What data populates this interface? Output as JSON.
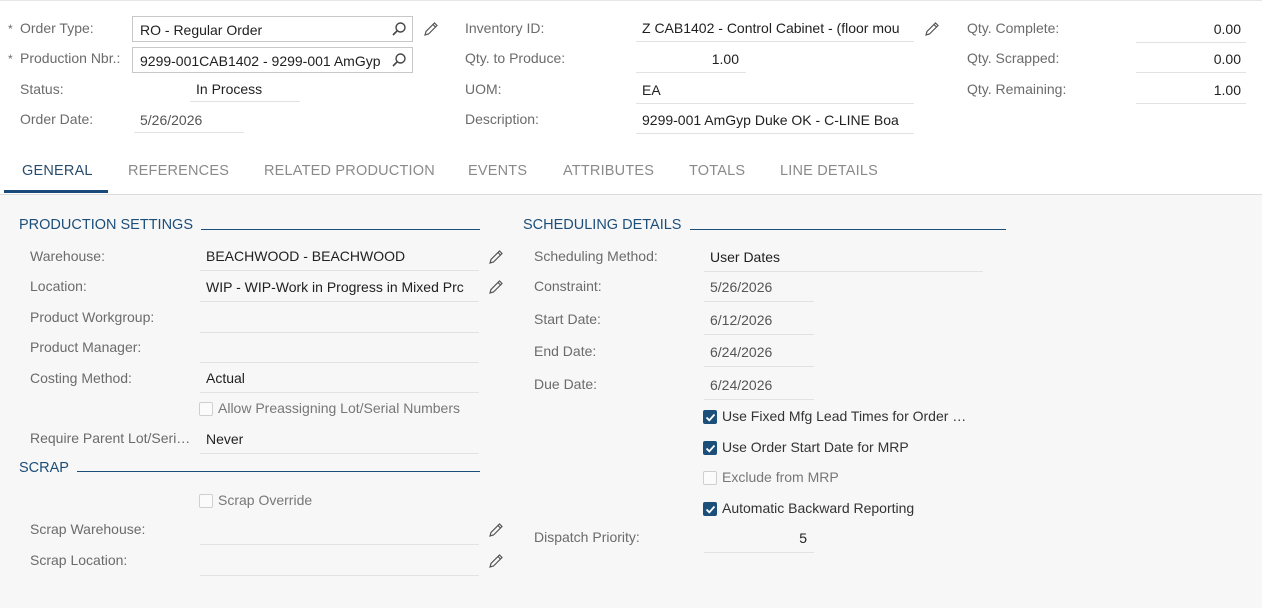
{
  "header": {
    "order_type": {
      "label": "Order Type:",
      "value": "RO - Regular Order"
    },
    "production_nbr": {
      "label": "Production Nbr.:",
      "value": "9299-001CAB1402 - 9299-001 AmGyp"
    },
    "status": {
      "label": "Status:",
      "value": "In Process"
    },
    "order_date": {
      "label": "Order Date:",
      "value": "5/26/2026"
    },
    "inventory_id": {
      "label": "Inventory ID:",
      "value": "Z CAB1402 - Control Cabinet - (floor mou"
    },
    "qty_to_produce": {
      "label": "Qty. to Produce:",
      "value": "1.00"
    },
    "uom": {
      "label": "UOM:",
      "value": "EA"
    },
    "description": {
      "label": "Description:",
      "value": "9299-001 AmGyp Duke OK - C-LINE Boa"
    },
    "qty_complete": {
      "label": "Qty. Complete:",
      "value": "0.00"
    },
    "qty_scrapped": {
      "label": "Qty. Scrapped:",
      "value": "0.00"
    },
    "qty_remaining": {
      "label": "Qty. Remaining:",
      "value": "1.00"
    },
    "required_mark": "*"
  },
  "tabs": [
    "GENERAL",
    "REFERENCES",
    "RELATED PRODUCTION",
    "EVENTS",
    "ATTRIBUTES",
    "TOTALS",
    "LINE DETAILS"
  ],
  "production_settings": {
    "title": "PRODUCTION SETTINGS",
    "warehouse": {
      "label": "Warehouse:",
      "value": "BEACHWOOD - BEACHWOOD"
    },
    "location": {
      "label": "Location:",
      "value": "WIP - WIP-Work in Progress in Mixed Prc"
    },
    "product_workgroup": {
      "label": "Product Workgroup:",
      "value": ""
    },
    "product_manager": {
      "label": "Product Manager:",
      "value": ""
    },
    "costing_method": {
      "label": "Costing Method:",
      "value": "Actual"
    },
    "allow_preassigning": {
      "label": "Allow Preassigning Lot/Serial Numbers",
      "checked": false
    },
    "require_parent_lot": {
      "label": "Require Parent Lot/Seri…",
      "value": "Never"
    }
  },
  "scrap": {
    "title": "SCRAP",
    "scrap_override": {
      "label": "Scrap Override",
      "checked": false
    },
    "scrap_warehouse": {
      "label": "Scrap Warehouse:",
      "value": ""
    },
    "scrap_location": {
      "label": "Scrap Location:",
      "value": ""
    }
  },
  "scheduling": {
    "title": "SCHEDULING DETAILS",
    "scheduling_method": {
      "label": "Scheduling Method:",
      "value": "User Dates"
    },
    "constraint": {
      "label": "Constraint:",
      "value": "5/26/2026"
    },
    "start_date": {
      "label": "Start Date:",
      "value": "6/12/2026"
    },
    "end_date": {
      "label": "End Date:",
      "value": "6/24/2026"
    },
    "due_date": {
      "label": "Due Date:",
      "value": "6/24/2026"
    },
    "fixed_mfg_lead": {
      "label": "Use Fixed Mfg Lead Times for Order …",
      "checked": true
    },
    "order_start_mrp": {
      "label": "Use Order Start Date for MRP",
      "checked": true
    },
    "exclude_mrp": {
      "label": "Exclude from MRP",
      "checked": false
    },
    "auto_backward": {
      "label": "Automatic Backward Reporting",
      "checked": true
    },
    "dispatch_priority": {
      "label": "Dispatch Priority:",
      "value": "5"
    }
  },
  "colors": {
    "accent": "#1c4e7a",
    "label": "#6b6b6b",
    "panel_bg": "#f7f7f7"
  }
}
